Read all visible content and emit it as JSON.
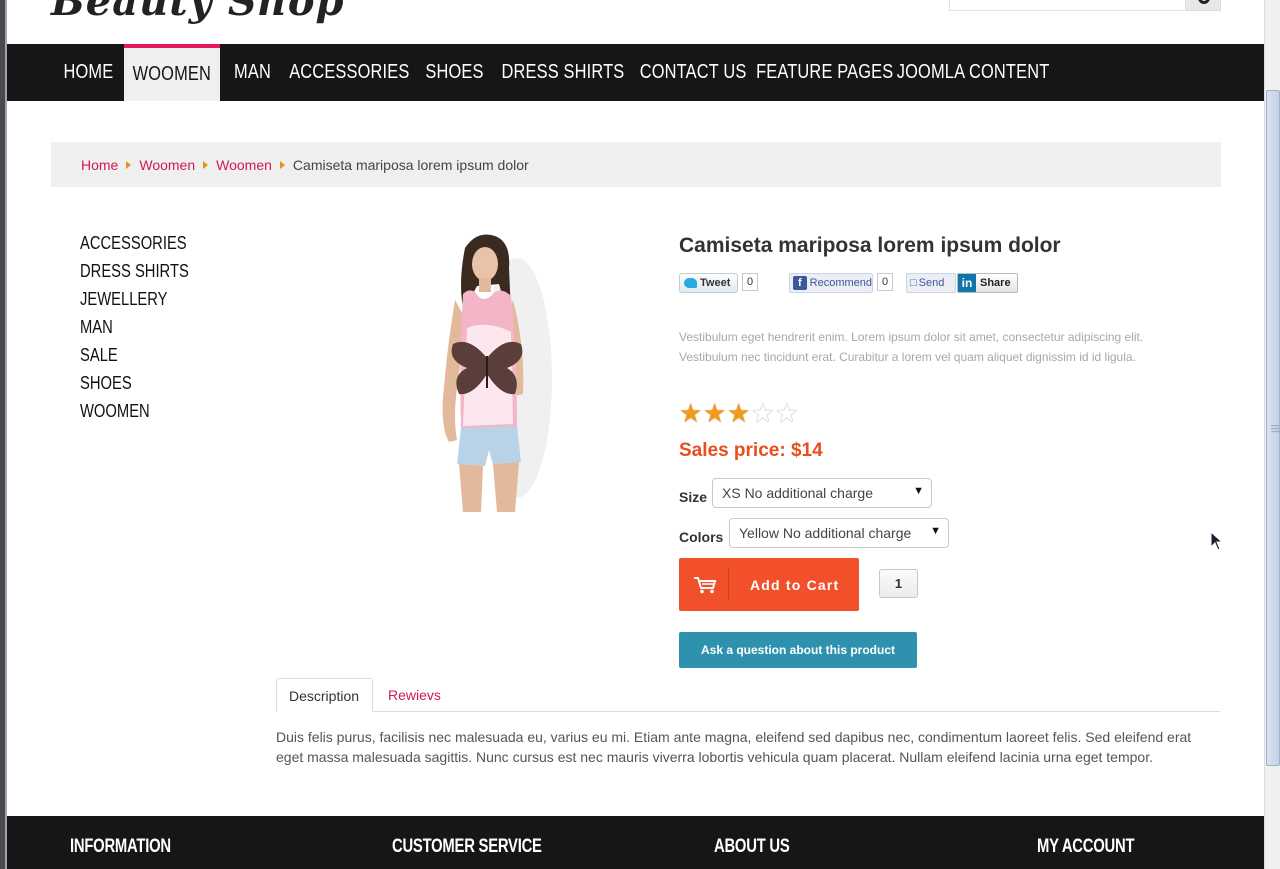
{
  "header": {
    "logo_text": "Beauty Shop",
    "search_placeholder": ""
  },
  "nav": {
    "items": [
      {
        "label": "HOME"
      },
      {
        "label": "WOOMEN",
        "active": true
      },
      {
        "label": "MAN"
      },
      {
        "label": "ACCESSORIES"
      },
      {
        "label": "SHOES"
      },
      {
        "label": "DRESS SHIRTS"
      },
      {
        "label": "CONTACT US"
      },
      {
        "label": "FEATURE PAGES"
      },
      {
        "label": "JOOMLA CONTENT"
      }
    ]
  },
  "breadcrumb": {
    "items": [
      "Home",
      "Woomen",
      "Woomen"
    ],
    "current": "Camiseta mariposa lorem ipsum dolor"
  },
  "sidebar": {
    "categories": [
      "ACCESSORIES",
      "DRESS SHIRTS",
      "JEWELLERY",
      "MAN",
      "SALE",
      "SHOES",
      "WOOMEN"
    ]
  },
  "product": {
    "title": "Camiseta mariposa lorem ipsum dolor",
    "social": {
      "tweet_label": "Tweet",
      "tweet_count": "0",
      "recommend_label": "Recommend",
      "recommend_count": "0",
      "send_label": "Send",
      "share_label": "Share"
    },
    "short_description": "Vestibulum eget hendrerit enim. Lorem ipsum dolor sit amet, consectetur adipiscing elit. Vestibulum nec tincidunt erat. Curabitur a lorem vel quam aliquet dignissim id id ligula.",
    "rating": 3,
    "rating_max": 5,
    "price_text": "Sales price: $14",
    "size_label": "Size",
    "size_value": "XS No additional charge",
    "colors_label": "Colors",
    "colors_value": "Yellow No additional charge",
    "add_to_cart_label": "Add to Cart",
    "quantity": "1",
    "ask_question_label": "Ask a question about this product"
  },
  "tabs": {
    "items": [
      {
        "label": "Description",
        "active": true
      },
      {
        "label": "Rewievs",
        "active": false
      }
    ],
    "content": "Duis felis purus, facilisis nec malesuada eu, varius eu mi. Etiam ante magna, eleifend sed dapibus nec, condimentum laoreet felis. Sed eleifend erat eget massa malesuada sagittis. Nunc cursus est nec mauris viverra lobortis vehicula quam placerat. Nullam eleifend lacinia urna eget tempor."
  },
  "footer": {
    "headings": [
      "INFORMATION",
      "CUSTOMER SERVICE",
      "ABOUT US",
      "MY ACCOUNT"
    ]
  },
  "colors": {
    "accent_pink": "#e6195a",
    "price_orange": "#e84e1c",
    "cart_button": "#f2502a",
    "ask_button": "#2e91ae",
    "nav_bg": "#161616"
  },
  "icons": [
    "search-icon",
    "cart-icon",
    "twitter-icon",
    "facebook-icon",
    "linkedin-icon",
    "star-icon",
    "chevron-down-icon"
  ]
}
